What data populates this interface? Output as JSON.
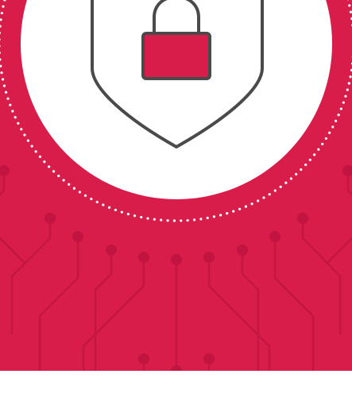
{
  "colors": {
    "background": "#d91d4a",
    "circuit_lines": "#c41642",
    "circuit_nodes": "#c21441",
    "inner_circle": "#ffffff",
    "dot_ring": "#ffffff",
    "shield_outline": "#4a4a4a",
    "padlock_body": "#d91d4a",
    "page_background": "#ffffff"
  },
  "icons": {
    "shield": "shield-icon",
    "padlock": "padlock-icon"
  }
}
